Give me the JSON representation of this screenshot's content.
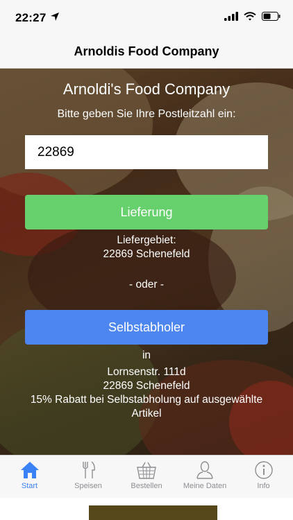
{
  "status": {
    "time": "22:27"
  },
  "nav": {
    "title": "Arnoldis Food Company"
  },
  "main": {
    "title": "Arnoldi's Food Company",
    "zip_prompt": "Bitte geben Sie Ihre Postleitzahl ein:",
    "zip_value": "22869",
    "delivery_label": "Lieferung",
    "delivery_area_label": "Liefergebiet:",
    "delivery_area_value": "22869 Schenefeld",
    "or_label": "- oder -",
    "pickup_label": "Selbstabholer",
    "pickup_in": "in",
    "pickup_street": "Lornsenstr. 111d",
    "pickup_city": "22869 Schenefeld",
    "pickup_discount": "15% Rabatt bei Selbstabholung auf ausgewählte Artikel"
  },
  "tabs": [
    {
      "label": "Start",
      "icon": "home-icon",
      "active": true
    },
    {
      "label": "Speisen",
      "icon": "cutlery-icon",
      "active": false
    },
    {
      "label": "Bestellen",
      "icon": "basket-icon",
      "active": false
    },
    {
      "label": "Meine Daten",
      "icon": "user-icon",
      "active": false
    },
    {
      "label": "Info",
      "icon": "info-icon",
      "active": false
    }
  ],
  "colors": {
    "delivery_button": "#66d06d",
    "pickup_button": "#4e86f0",
    "tab_active": "#3b82f6",
    "tab_inactive": "#8e8e93"
  }
}
